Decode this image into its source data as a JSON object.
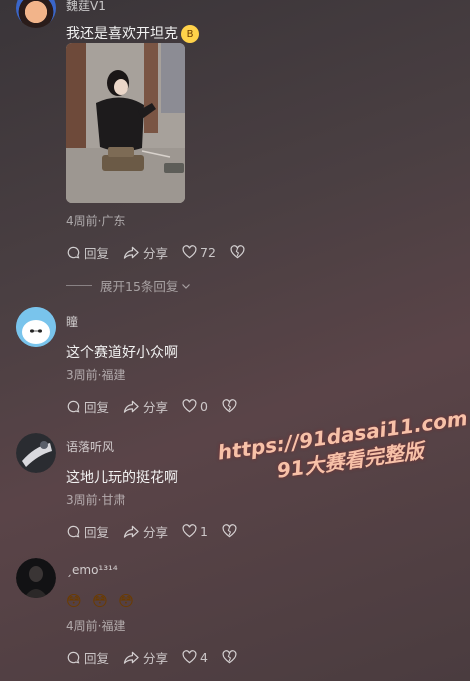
{
  "comments": [
    {
      "user": "魏莛V1",
      "text": "我还是喜欢开坦克",
      "emoji": "😎",
      "meta": "4周前·广东",
      "reply": "回复",
      "share": "分享",
      "likes": "72"
    },
    {
      "user": "瞳",
      "text": "这个赛道好小众啊",
      "meta": "3周前·福建",
      "reply": "回复",
      "share": "分享",
      "likes": "0"
    },
    {
      "user": "语落听风",
      "text": "这地儿玩的挺花啊",
      "meta": "3周前·甘肃",
      "reply": "回复",
      "share": "分享",
      "likes": "1"
    },
    {
      "user": "ˏemo¹³¹⁴",
      "emojis": [
        "😳",
        "😳",
        "😳"
      ],
      "meta": "4周前·福建",
      "reply": "回复",
      "share": "分享",
      "likes": "4"
    }
  ],
  "expand_replies": "展开15条回复",
  "watermark": {
    "line1": "https://91dasai11.com",
    "line2": "91大赛看完整版"
  },
  "colors": {
    "accent_watermark": "#f7c1a8"
  }
}
